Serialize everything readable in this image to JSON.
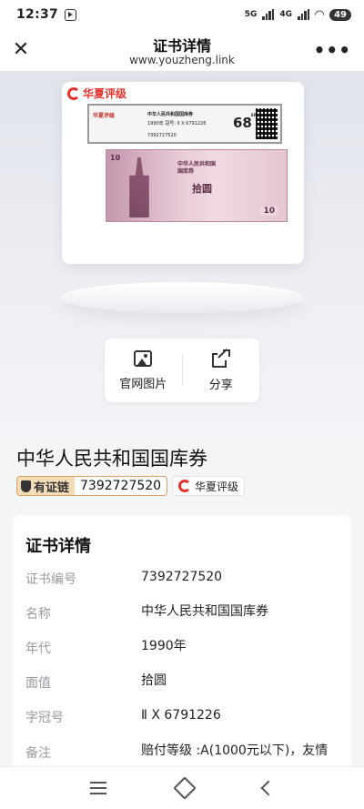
{
  "status_bar": {
    "time": "12:37",
    "network_5g": "5G",
    "network_4g": "4G",
    "battery": "49"
  },
  "nav": {
    "title": "证书详情",
    "url": "www.youzheng.link"
  },
  "slab": {
    "brand": "华夏评级",
    "label_name": "中华人民共和国国库券",
    "label_year": "1990年",
    "label_serial": "冠号: II X 6791226",
    "label_cert": "7392727520",
    "label_grade": "68",
    "label_grade_suffix": "EPQ",
    "note_line1": "中华人民共和国",
    "note_line2": "国库券",
    "note_value": "拾圆",
    "note_corner": "10",
    "note_corner2": "10"
  },
  "actions": {
    "official_image": "官网图片",
    "share": "分享"
  },
  "product": {
    "title": "中华人民共和国国库券",
    "chain_label": "有证链",
    "cert_number": "7392727520",
    "brand": "华夏评级"
  },
  "details": {
    "title": "证书详情",
    "rows": [
      {
        "key": "证书编号",
        "value": "7392727520"
      },
      {
        "key": "名称",
        "value": "中华人民共和国国库券"
      },
      {
        "key": "年代",
        "value": "1990年"
      },
      {
        "key": "面值",
        "value": "拾圆"
      },
      {
        "key": "字冠号",
        "value": "Ⅱ X 6791226"
      },
      {
        "key": "备注",
        "value": "赔付等级 :A(1000元以下)，友情"
      }
    ]
  }
}
